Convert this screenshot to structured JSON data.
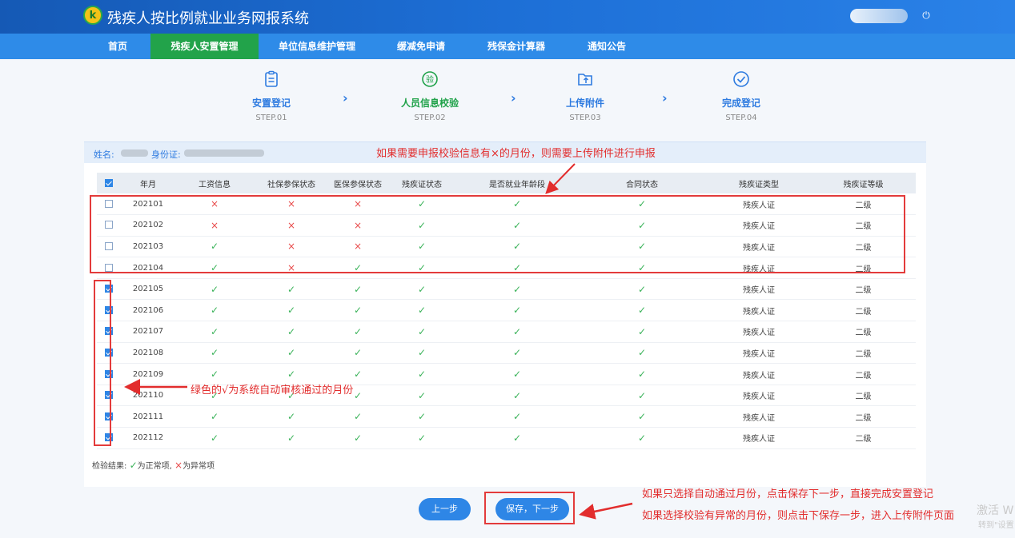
{
  "app": {
    "title": "残疾人按比例就业业务网报系统",
    "logo_letter": "k",
    "user_name": ""
  },
  "nav": [
    "首页",
    "残疾人安置管理",
    "单位信息维护管理",
    "缓减免申请",
    "残保金计算器",
    "通知公告"
  ],
  "steps": [
    {
      "label": "安置登记",
      "sub": "STEP.01"
    },
    {
      "label": "人员信息校验",
      "sub": "STEP.02"
    },
    {
      "label": "上传附件",
      "sub": "STEP.03"
    },
    {
      "label": "完成登记",
      "sub": "STEP.04"
    }
  ],
  "info": {
    "name_label": "姓名:",
    "id_label": "身份证:"
  },
  "table": {
    "headers": [
      "年月",
      "工资信息",
      "社保参保状态",
      "医保参保状态",
      "残疾证状态",
      "是否就业年龄段",
      "合同状态",
      "残疾证类型",
      "残疾证等级"
    ],
    "rows": [
      {
        "month": "202101",
        "checked": false,
        "wage": "×",
        "social": "×",
        "medical": "×",
        "cert": "✓",
        "age": "✓",
        "contract": "✓",
        "type": "残疾人证",
        "level": "二级"
      },
      {
        "month": "202102",
        "checked": false,
        "wage": "×",
        "social": "×",
        "medical": "×",
        "cert": "✓",
        "age": "✓",
        "contract": "✓",
        "type": "残疾人证",
        "level": "二级"
      },
      {
        "month": "202103",
        "checked": false,
        "wage": "✓",
        "social": "×",
        "medical": "×",
        "cert": "✓",
        "age": "✓",
        "contract": "✓",
        "type": "残疾人证",
        "level": "二级"
      },
      {
        "month": "202104",
        "checked": false,
        "wage": "✓",
        "social": "×",
        "medical": "✓",
        "cert": "✓",
        "age": "✓",
        "contract": "✓",
        "type": "残疾人证",
        "level": "二级"
      },
      {
        "month": "202105",
        "checked": true,
        "wage": "✓",
        "social": "✓",
        "medical": "✓",
        "cert": "✓",
        "age": "✓",
        "contract": "✓",
        "type": "残疾人证",
        "level": "二级"
      },
      {
        "month": "202106",
        "checked": true,
        "wage": "✓",
        "social": "✓",
        "medical": "✓",
        "cert": "✓",
        "age": "✓",
        "contract": "✓",
        "type": "残疾人证",
        "level": "二级"
      },
      {
        "month": "202107",
        "checked": true,
        "wage": "✓",
        "social": "✓",
        "medical": "✓",
        "cert": "✓",
        "age": "✓",
        "contract": "✓",
        "type": "残疾人证",
        "level": "二级"
      },
      {
        "month": "202108",
        "checked": true,
        "wage": "✓",
        "social": "✓",
        "medical": "✓",
        "cert": "✓",
        "age": "✓",
        "contract": "✓",
        "type": "残疾人证",
        "level": "二级"
      },
      {
        "month": "202109",
        "checked": true,
        "wage": "✓",
        "social": "✓",
        "medical": "✓",
        "cert": "✓",
        "age": "✓",
        "contract": "✓",
        "type": "残疾人证",
        "level": "二级"
      },
      {
        "month": "202110",
        "checked": true,
        "wage": "✓",
        "social": "✓",
        "medical": "✓",
        "cert": "✓",
        "age": "✓",
        "contract": "✓",
        "type": "残疾人证",
        "level": "二级"
      },
      {
        "month": "202111",
        "checked": true,
        "wage": "✓",
        "social": "✓",
        "medical": "✓",
        "cert": "✓",
        "age": "✓",
        "contract": "✓",
        "type": "残疾人证",
        "level": "二级"
      },
      {
        "month": "202112",
        "checked": true,
        "wage": "✓",
        "social": "✓",
        "medical": "✓",
        "cert": "✓",
        "age": "✓",
        "contract": "✓",
        "type": "残疾人证",
        "level": "二级"
      }
    ]
  },
  "legend": {
    "prefix": "检验结果:",
    "ok_text": "为正常项,",
    "bad_text": "为异常项",
    "ok_mark": "✓",
    "bad_mark": "×"
  },
  "buttons": {
    "prev": "上一步",
    "save_next": "保存，下一步"
  },
  "annotations": {
    "top": "如果需要申报校验信息有×的月份，则需要上传附件进行申报",
    "left": "绿色的√为系统自动审核通过的月份",
    "bottom1": "如果只选择自动通过月份，点击保存下一步，直接完成安置登记",
    "bottom2": "如果选择校验有异常的月份，则点击下保存一步，进入上传附件页面"
  },
  "watermark": {
    "line1": "激活 W",
    "line2": "转到\"设置"
  },
  "colors": {
    "nav_bg": "#2e8be8",
    "nav_active": "#22a34a",
    "ok": "#3bb35a",
    "bad": "#e84b4b",
    "annotation": "#e22d2d"
  }
}
